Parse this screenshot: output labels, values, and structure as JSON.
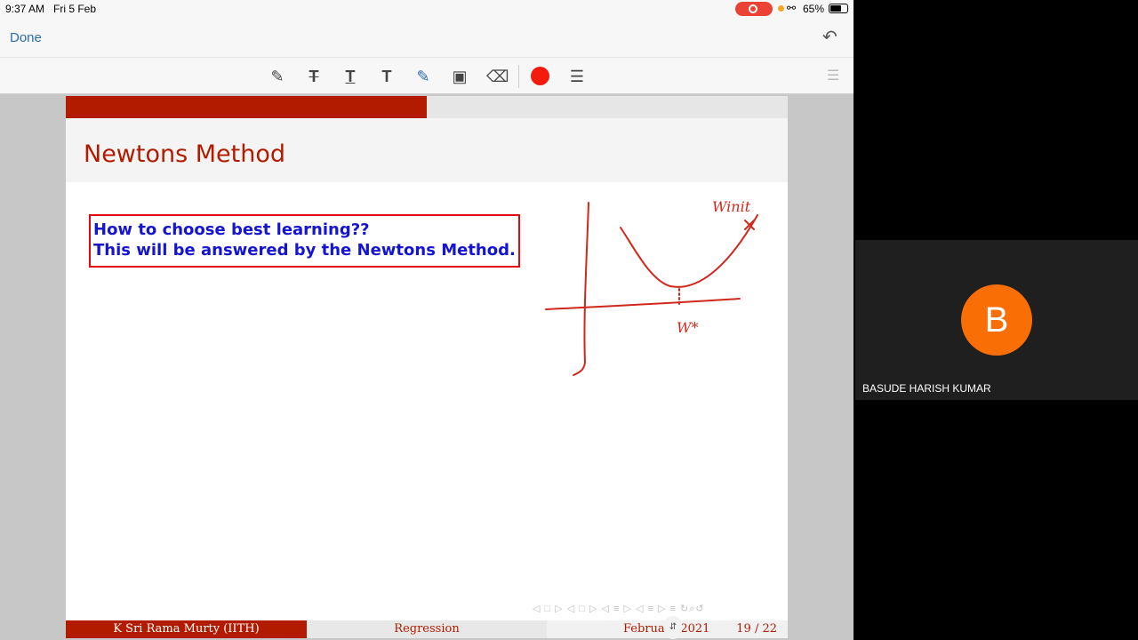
{
  "status_bar": {
    "time": "9:37 AM",
    "date": "Fri 5 Feb",
    "battery_percent": "65%",
    "battery_level": 0.65
  },
  "top_bar": {
    "done_label": "Done"
  },
  "toolbar": {
    "icons": [
      "pen-icon",
      "strikethrough-icon",
      "underline-icon",
      "text-icon",
      "pencil-icon",
      "comment-icon",
      "eraser-icon",
      "color-swatch",
      "line-width-icon"
    ],
    "active_color": "#f41a0c"
  },
  "slide": {
    "title": "Newtons Method",
    "progress_fraction": 0.5,
    "box_lines": [
      "How to choose best learning??",
      "This will be answered by the Newtons Method."
    ],
    "handwritten": {
      "w_init": "Winit",
      "w_star": "W*"
    },
    "footer": {
      "author": "K Sri Rama Murty  (IITH)",
      "topic": "Regression",
      "date": "February 2021",
      "pages": "19 / 22"
    }
  },
  "participant": {
    "initial": "B",
    "name": "BASUDE HARISH KUMAR",
    "avatar_color": "#fa6e06"
  },
  "colors": {
    "slide_red": "#b31b00",
    "box_border": "#e30613",
    "box_text": "#1414d2",
    "ink": "#d0281c"
  }
}
